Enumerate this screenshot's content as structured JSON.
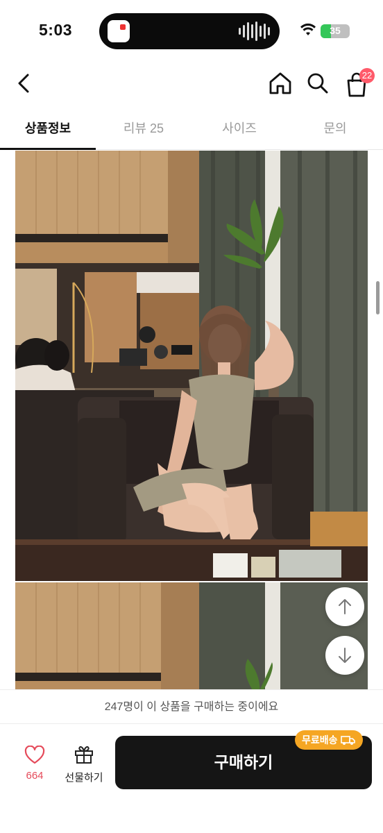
{
  "status_bar": {
    "time": "5:03",
    "battery_label": "35",
    "battery_level": 0.35
  },
  "header": {
    "cart_count": "22",
    "icons": [
      "back-icon",
      "home-icon",
      "search-icon",
      "cart-icon"
    ]
  },
  "tabs": [
    {
      "label": "상품정보",
      "active": true
    },
    {
      "label": "리뷰 25",
      "active": false
    },
    {
      "label": "사이즈",
      "active": false
    },
    {
      "label": "문의",
      "active": false
    }
  ],
  "buyers_notice": "247명이 이 상품을 구매하는 중이에요",
  "bottom_bar": {
    "like_count": "664",
    "gift_label": "선물하기",
    "buy_label": "구매하기",
    "free_shipping_label": "무료배송"
  },
  "colors": {
    "accent": "#151515",
    "like": "#e54a5a",
    "badge": "#ff5a6a",
    "free_shipping": "#f5a623"
  }
}
